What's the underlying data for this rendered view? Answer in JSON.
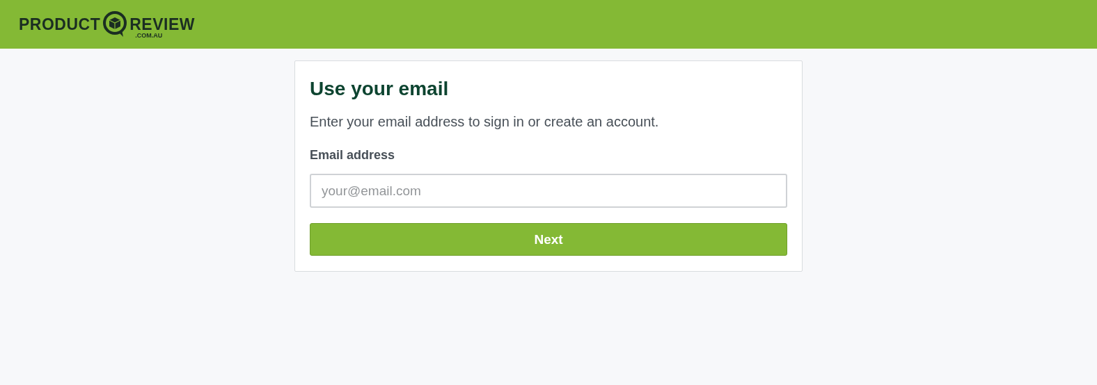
{
  "logo": {
    "left": "PRODUCT",
    "right": "REVIEW",
    "domain": ".COM.AU"
  },
  "card": {
    "title": "Use your email",
    "description": "Enter your email address to sign in or create an account.",
    "field_label": "Email address",
    "email": {
      "placeholder": "your@email.com"
    },
    "button": "Next"
  }
}
